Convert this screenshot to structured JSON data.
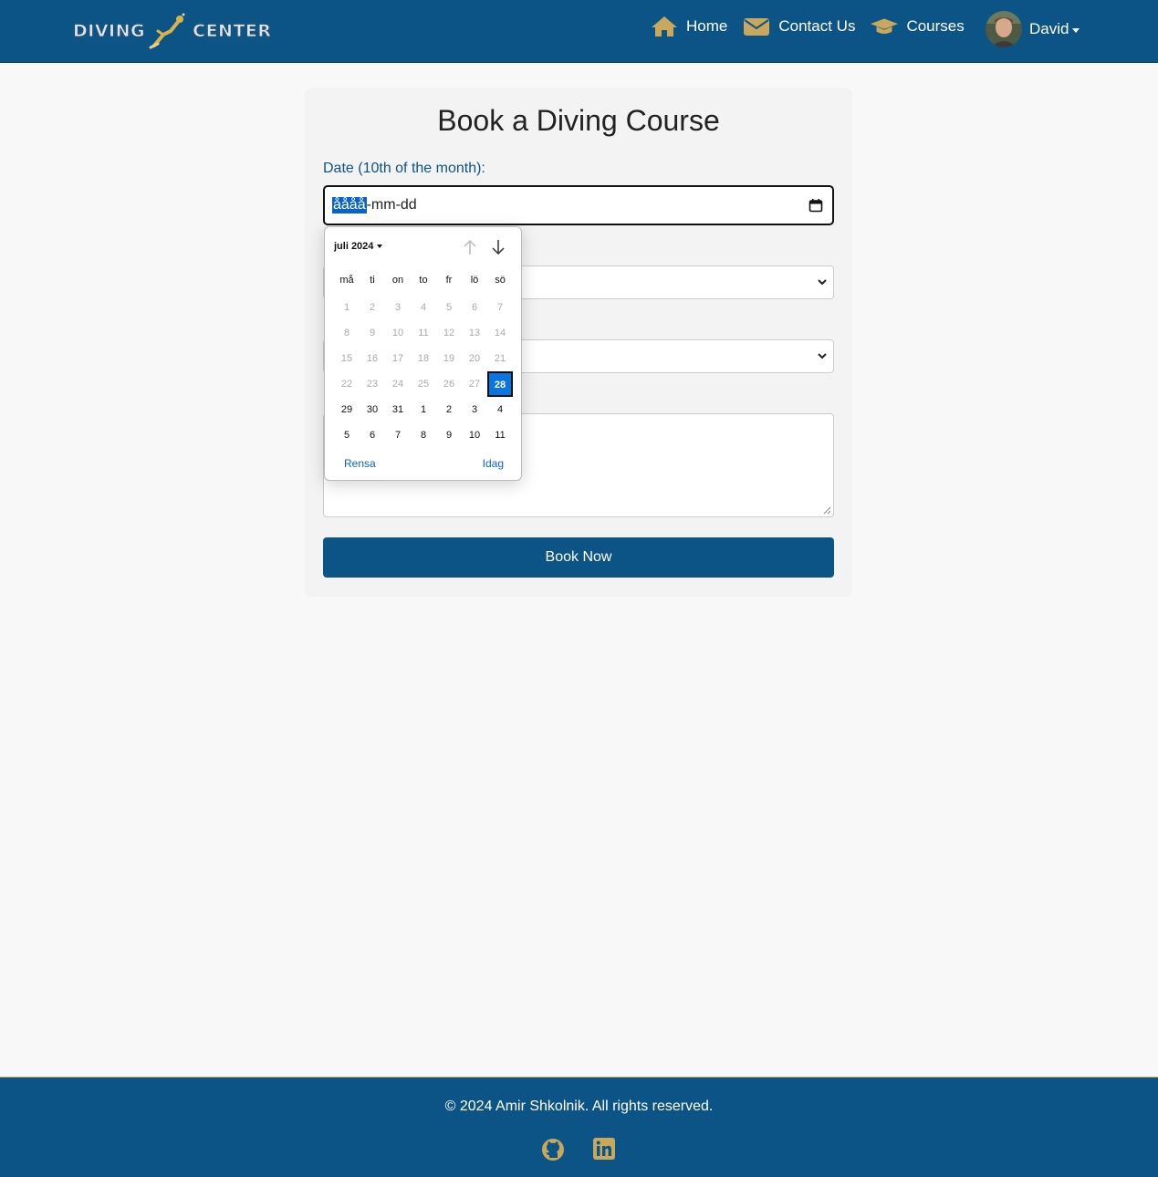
{
  "brand": {
    "logo_left": "DIVING",
    "logo_right": "CENTER"
  },
  "nav": {
    "links": [
      {
        "label": "Home",
        "icon": "home-icon"
      },
      {
        "label": "Contact Us",
        "icon": "envelope-icon"
      },
      {
        "label": "Courses",
        "icon": "graduation-cap-icon"
      }
    ],
    "user": {
      "name": "David"
    }
  },
  "form": {
    "title": "Book a Diving Course",
    "date_label": "Date (10th of the month):",
    "date_placeholder": {
      "year": "åååå",
      "rest": "-mm-dd"
    },
    "submit_label": "Book Now"
  },
  "datepicker": {
    "month_label": "juli 2024",
    "weekdays": [
      "må",
      "ti",
      "on",
      "to",
      "fr",
      "lö",
      "sö"
    ],
    "days": [
      {
        "d": "1",
        "dim": true
      },
      {
        "d": "2",
        "dim": true
      },
      {
        "d": "3",
        "dim": true
      },
      {
        "d": "4",
        "dim": true
      },
      {
        "d": "5",
        "dim": true
      },
      {
        "d": "6",
        "dim": true
      },
      {
        "d": "7",
        "dim": true
      },
      {
        "d": "8",
        "dim": true
      },
      {
        "d": "9",
        "dim": true
      },
      {
        "d": "10",
        "dim": true
      },
      {
        "d": "11",
        "dim": true
      },
      {
        "d": "12",
        "dim": true
      },
      {
        "d": "13",
        "dim": true
      },
      {
        "d": "14",
        "dim": true
      },
      {
        "d": "15",
        "dim": true
      },
      {
        "d": "16",
        "dim": true
      },
      {
        "d": "17",
        "dim": true
      },
      {
        "d": "18",
        "dim": true
      },
      {
        "d": "19",
        "dim": true
      },
      {
        "d": "20",
        "dim": true
      },
      {
        "d": "21",
        "dim": true
      },
      {
        "d": "22",
        "dim": true
      },
      {
        "d": "23",
        "dim": true
      },
      {
        "d": "24",
        "dim": true
      },
      {
        "d": "25",
        "dim": true
      },
      {
        "d": "26",
        "dim": true
      },
      {
        "d": "27",
        "dim": true
      },
      {
        "d": "28",
        "today": true
      },
      {
        "d": "29"
      },
      {
        "d": "30"
      },
      {
        "d": "31"
      },
      {
        "d": "1"
      },
      {
        "d": "2"
      },
      {
        "d": "3"
      },
      {
        "d": "4"
      },
      {
        "d": "5"
      },
      {
        "d": "6"
      },
      {
        "d": "7"
      },
      {
        "d": "8"
      },
      {
        "d": "9"
      },
      {
        "d": "10"
      },
      {
        "d": "11"
      }
    ],
    "clear_label": "Rensa",
    "today_label": "Idag"
  },
  "footer": {
    "copyright": "© 2024 Amir Shkolnik. All rights reserved.",
    "social": [
      "github-icon",
      "linkedin-icon"
    ]
  },
  "colors": {
    "primary": "#0d5486",
    "accent": "#c9a85c",
    "background": "#f8f8f8",
    "selected_day": "#0a74e0"
  }
}
